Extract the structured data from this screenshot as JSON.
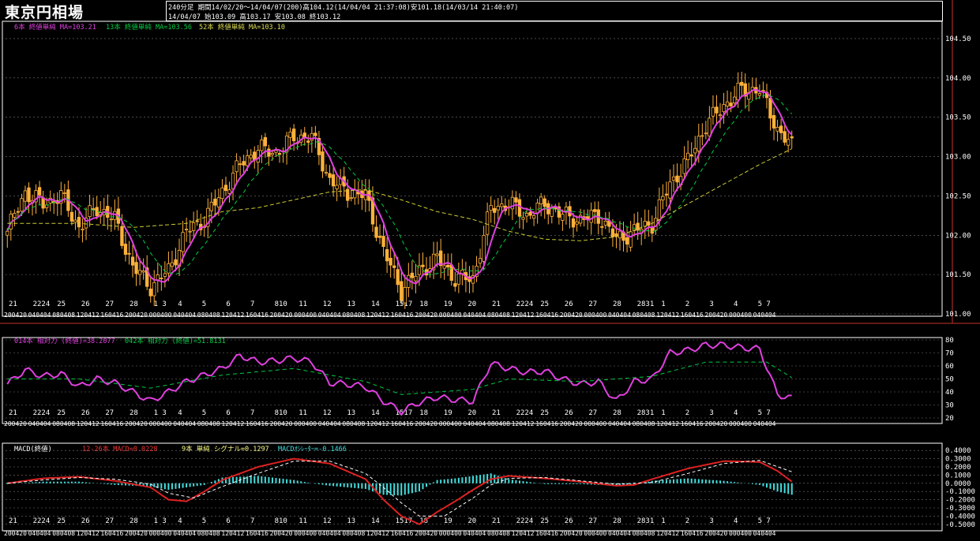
{
  "header": {
    "title": "東京円相場",
    "info_line1": "240分足  期間14/02/20～14/04/07(200)高104.12(14/04/04 21:37:08)安101.18(14/03/14 21:40:07)",
    "info_line2": "14/04/07         始103.09 高103.17 安103.08 終103.12"
  },
  "colors": {
    "background": "#000000",
    "bull": "#ffb13b",
    "bear": "#ffb13b",
    "ma6": "#e040e0",
    "ma13": "#00cc44",
    "ma52": "#cccc33",
    "rsi14": "#e040e0",
    "rsi42": "#00cc44",
    "macd": "#dd2222",
    "signal": "#ffffff",
    "osc": "#44dddd"
  },
  "x_axis": {
    "day_labels": [
      "21",
      "2224",
      "25",
      "26",
      "27",
      "28",
      "1 3",
      "4",
      "5",
      "6",
      "7",
      "810",
      "11",
      "12",
      "13",
      "14",
      "1517",
      "18",
      "19",
      "20",
      "21",
      "2224",
      "25",
      "26",
      "27",
      "28",
      "2831",
      "1",
      "2",
      "3",
      "4",
      "5 7"
    ],
    "time_labels": [
      "20",
      "04",
      "08",
      "12",
      "16",
      "20",
      "00",
      "04",
      "08",
      "12",
      "16",
      "20",
      "00",
      "04",
      "08",
      "12",
      "16",
      "20",
      "00",
      "04",
      "08",
      "12",
      "16",
      "20",
      "00",
      "04",
      "08",
      "12",
      "16",
      "20",
      "00",
      "04"
    ]
  },
  "chart_data": [
    {
      "type": "candlestick",
      "legend": [
        {
          "text": "6本 終値単純 MA=103.21",
          "key": "ma6"
        },
        {
          "text": "13本 終値単純 MA=103.56",
          "key": "ma13"
        },
        {
          "text": "52本 終値単純 MA=103.10",
          "key": "ma52"
        }
      ],
      "ylim": [
        101.0,
        104.7
      ],
      "ticks": [
        "101.00",
        "101.50",
        "102.00",
        "102.50",
        "103.00",
        "103.50",
        "104.00",
        "104.50"
      ],
      "grid": true,
      "close_path": [
        [
          0,
          102.05
        ],
        [
          5,
          102.55
        ],
        [
          10,
          102.4
        ],
        [
          15,
          102.5
        ],
        [
          20,
          102.1
        ],
        [
          25,
          102.35
        ],
        [
          30,
          102.2
        ],
        [
          35,
          101.6
        ],
        [
          40,
          101.35
        ],
        [
          45,
          101.55
        ],
        [
          50,
          102.05
        ],
        [
          55,
          102.2
        ],
        [
          60,
          102.55
        ],
        [
          65,
          102.9
        ],
        [
          70,
          103.1
        ],
        [
          75,
          103.05
        ],
        [
          80,
          103.25
        ],
        [
          85,
          103.25
        ],
        [
          90,
          102.7
        ],
        [
          95,
          102.55
        ],
        [
          100,
          102.5
        ],
        [
          105,
          101.8
        ],
        [
          110,
          101.3
        ],
        [
          115,
          101.55
        ],
        [
          120,
          101.7
        ],
        [
          125,
          101.45
        ],
        [
          130,
          101.45
        ],
        [
          135,
          102.35
        ],
        [
          140,
          102.4
        ],
        [
          145,
          102.25
        ],
        [
          150,
          102.4
        ],
        [
          155,
          102.25
        ],
        [
          160,
          102.2
        ],
        [
          165,
          102.25
        ],
        [
          170,
          101.95
        ],
        [
          175,
          102.05
        ],
        [
          180,
          102.15
        ],
        [
          185,
          102.65
        ],
        [
          190,
          102.95
        ],
        [
          195,
          103.4
        ],
        [
          200,
          103.65
        ],
        [
          205,
          103.85
        ],
        [
          210,
          103.85
        ],
        [
          215,
          103.35
        ],
        [
          219,
          103.12
        ]
      ],
      "ma52": [
        [
          0,
          102.15
        ],
        [
          20,
          102.15
        ],
        [
          35,
          102.1
        ],
        [
          50,
          102.15
        ],
        [
          60,
          102.3
        ],
        [
          70,
          102.35
        ],
        [
          80,
          102.45
        ],
        [
          90,
          102.55
        ],
        [
          100,
          102.58
        ],
        [
          110,
          102.45
        ],
        [
          120,
          102.3
        ],
        [
          130,
          102.2
        ],
        [
          140,
          102.05
        ],
        [
          150,
          101.95
        ],
        [
          160,
          101.93
        ],
        [
          170,
          101.98
        ],
        [
          180,
          102.15
        ],
        [
          190,
          102.4
        ],
        [
          200,
          102.65
        ],
        [
          210,
          102.9
        ],
        [
          219,
          103.1
        ]
      ]
    },
    {
      "type": "line",
      "legend": [
        {
          "text": "014本 相対力 (終値)=38.2077",
          "key": "rsi14"
        },
        {
          "text": "042本 相対力 (終値)=51.8131",
          "key": "rsi42"
        }
      ],
      "ylim": [
        20,
        80
      ],
      "ticks": [
        "20",
        "30",
        "40",
        "50",
        "60",
        "70",
        "80"
      ],
      "series": [
        {
          "key": "rsi14",
          "values": [
            [
              0,
              46
            ],
            [
              5,
              57
            ],
            [
              10,
              52
            ],
            [
              15,
              54
            ],
            [
              20,
              44
            ],
            [
              25,
              50
            ],
            [
              30,
              47
            ],
            [
              35,
              40
            ],
            [
              40,
              33
            ],
            [
              45,
              40
            ],
            [
              50,
              48
            ],
            [
              55,
              53
            ],
            [
              60,
              58
            ],
            [
              65,
              68
            ],
            [
              70,
              63
            ],
            [
              75,
              64
            ],
            [
              80,
              66
            ],
            [
              85,
              63
            ],
            [
              90,
              47
            ],
            [
              95,
              46
            ],
            [
              100,
              44
            ],
            [
              105,
              33
            ],
            [
              110,
              25
            ],
            [
              115,
              32
            ],
            [
              120,
              36
            ],
            [
              125,
              34
            ],
            [
              130,
              33
            ],
            [
              135,
              62
            ],
            [
              140,
              58
            ],
            [
              145,
              55
            ],
            [
              150,
              56
            ],
            [
              155,
              50
            ],
            [
              160,
              46
            ],
            [
              165,
              48
            ],
            [
              170,
              33
            ],
            [
              175,
              48
            ],
            [
              180,
              50
            ],
            [
              185,
              70
            ],
            [
              190,
              72
            ],
            [
              195,
              76
            ],
            [
              200,
              76
            ],
            [
              205,
              74
            ],
            [
              210,
              73
            ],
            [
              215,
              38
            ],
            [
              219,
              35
            ]
          ]
        },
        {
          "key": "rsi42",
          "values": [
            [
              0,
              50
            ],
            [
              20,
              50
            ],
            [
              40,
              43
            ],
            [
              60,
              53
            ],
            [
              80,
              58
            ],
            [
              100,
              48
            ],
            [
              110,
              38
            ],
            [
              130,
              42
            ],
            [
              140,
              50
            ],
            [
              160,
              48
            ],
            [
              180,
              52
            ],
            [
              195,
              63
            ],
            [
              212,
              63
            ],
            [
              219,
              51
            ]
          ]
        }
      ]
    },
    {
      "type": "line+bar",
      "legend": [
        {
          "text": "MACD(終値)",
          "key": "signal"
        },
        {
          "text": "12-26本 MACD=0.0228",
          "key": "macd"
        },
        {
          "text": "9本 単純 シグナル=0.1297",
          "key": "signal"
        },
        {
          "text": "MACDｵｼﾚｰﾀｰ=-0.1466",
          "key": "osc"
        }
      ],
      "ylim": [
        -0.55,
        0.45
      ],
      "ticks": [
        "0.4000",
        "0.3000",
        "0.2000",
        "0.1000",
        "0.0000",
        "-0.1000",
        "-0.2000",
        "-0.3000",
        "-0.4000",
        "-0.5000"
      ],
      "series": [
        {
          "key": "macd",
          "values": [
            [
              0,
              0.0
            ],
            [
              10,
              0.06
            ],
            [
              20,
              0.08
            ],
            [
              30,
              0.03
            ],
            [
              40,
              -0.05
            ],
            [
              45,
              -0.2
            ],
            [
              50,
              -0.22
            ],
            [
              55,
              -0.1
            ],
            [
              60,
              0.04
            ],
            [
              70,
              0.2
            ],
            [
              80,
              0.3
            ],
            [
              85,
              0.27
            ],
            [
              90,
              0.24
            ],
            [
              100,
              0.05
            ],
            [
              105,
              -0.2
            ],
            [
              110,
              -0.4
            ],
            [
              115,
              -0.5
            ],
            [
              120,
              -0.35
            ],
            [
              125,
              -0.22
            ],
            [
              130,
              -0.08
            ],
            [
              135,
              0.05
            ],
            [
              140,
              0.09
            ],
            [
              150,
              0.06
            ],
            [
              160,
              0.02
            ],
            [
              170,
              -0.03
            ],
            [
              175,
              -0.02
            ],
            [
              180,
              0.05
            ],
            [
              190,
              0.18
            ],
            [
              200,
              0.27
            ],
            [
              210,
              0.26
            ],
            [
              215,
              0.15
            ],
            [
              219,
              0.02
            ]
          ]
        },
        {
          "key": "signal",
          "values": [
            [
              0,
              0.0
            ],
            [
              10,
              0.04
            ],
            [
              20,
              0.07
            ],
            [
              30,
              0.05
            ],
            [
              40,
              -0.01
            ],
            [
              45,
              -0.12
            ],
            [
              52,
              -0.18
            ],
            [
              60,
              -0.04
            ],
            [
              70,
              0.12
            ],
            [
              80,
              0.27
            ],
            [
              90,
              0.27
            ],
            [
              100,
              0.12
            ],
            [
              105,
              -0.05
            ],
            [
              110,
              -0.24
            ],
            [
              115,
              -0.4
            ],
            [
              122,
              -0.4
            ],
            [
              130,
              -0.18
            ],
            [
              135,
              -0.02
            ],
            [
              140,
              0.06
            ],
            [
              150,
              0.07
            ],
            [
              160,
              0.03
            ],
            [
              170,
              -0.01
            ],
            [
              180,
              0.01
            ],
            [
              190,
              0.12
            ],
            [
              200,
              0.24
            ],
            [
              210,
              0.28
            ],
            [
              219,
              0.14
            ]
          ]
        },
        {
          "key": "osc",
          "values": [
            [
              0,
              -0.01
            ],
            [
              10,
              0.02
            ],
            [
              20,
              0.02
            ],
            [
              30,
              -0.02
            ],
            [
              40,
              -0.04
            ],
            [
              45,
              -0.08
            ],
            [
              50,
              -0.05
            ],
            [
              55,
              -0.02
            ],
            [
              60,
              0.07
            ],
            [
              70,
              0.09
            ],
            [
              80,
              0.04
            ],
            [
              85,
              0.0
            ],
            [
              90,
              -0.03
            ],
            [
              100,
              -0.07
            ],
            [
              105,
              -0.14
            ],
            [
              110,
              -0.15
            ],
            [
              115,
              -0.1
            ],
            [
              120,
              0.04
            ],
            [
              125,
              0.06
            ],
            [
              130,
              0.09
            ],
            [
              135,
              0.12
            ],
            [
              140,
              0.05
            ],
            [
              150,
              -0.01
            ],
            [
              160,
              -0.01
            ],
            [
              170,
              -0.03
            ],
            [
              175,
              -0.02
            ],
            [
              180,
              0.03
            ],
            [
              190,
              0.06
            ],
            [
              200,
              0.03
            ],
            [
              210,
              -0.02
            ],
            [
              215,
              -0.1
            ],
            [
              219,
              -0.14
            ]
          ]
        }
      ]
    }
  ]
}
